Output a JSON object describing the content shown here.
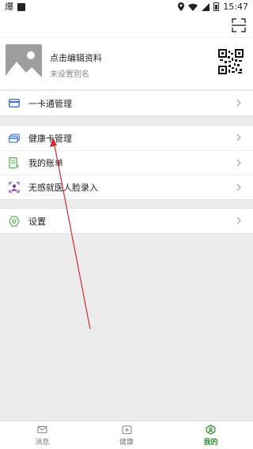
{
  "status_bar": {
    "left_glyph": "爆",
    "time": "15:47"
  },
  "top_bar": {
    "scan_icon": "scan-icon"
  },
  "profile": {
    "name": "点击编辑资料",
    "alias": "未设置别名",
    "avatar_icon": "image-placeholder-icon",
    "qr_icon": "qr-code-icon"
  },
  "menu": {
    "group1": [
      {
        "label": "一卡通管理",
        "icon": "card-icon",
        "color": "#3a6fd8"
      }
    ],
    "group2": [
      {
        "label": "健康卡管理",
        "icon": "health-card-icon",
        "color": "#3a6fd8"
      },
      {
        "label": "我的账单",
        "icon": "bill-icon",
        "color": "#5cb85c"
      },
      {
        "label": "无感就医人脸录入",
        "icon": "face-icon",
        "color": "#7a3fa0"
      }
    ],
    "group3": [
      {
        "label": "设置",
        "icon": "settings-icon",
        "color": "#5cb85c"
      }
    ]
  },
  "tabs": [
    {
      "label": "消息",
      "icon": "message-icon",
      "active": false
    },
    {
      "label": "健康",
      "icon": "health-icon",
      "active": false
    },
    {
      "label": "我的",
      "icon": "mine-icon",
      "active": true
    }
  ],
  "colors": {
    "accent": "#2d8c2d",
    "annotation": "#d22b2b"
  }
}
